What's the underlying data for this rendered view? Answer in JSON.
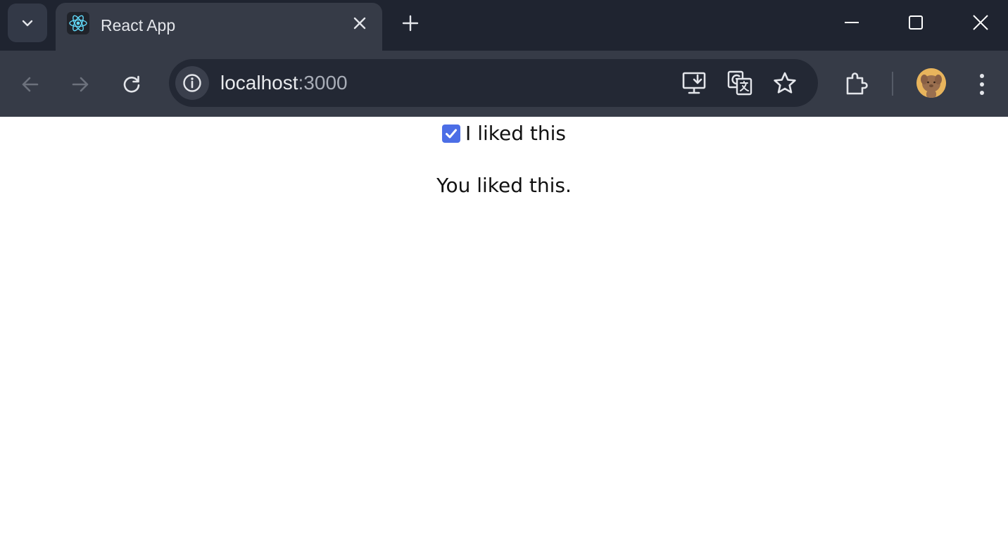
{
  "browser": {
    "tab": {
      "title": "React App",
      "favicon": "react-logo-icon"
    },
    "address_bar": {
      "host": "localhost",
      "port": ":3000"
    },
    "icons": {
      "tab_search": "chevron-down-icon",
      "tab_close": "close-icon",
      "new_tab": "plus-icon",
      "minimize": "minimize-icon",
      "maximize": "maximize-icon",
      "close_window": "close-icon",
      "back": "arrow-left-icon",
      "forward": "arrow-right-icon",
      "reload": "reload-icon",
      "site_info": "info-icon",
      "install_app": "install-app-icon",
      "translate": "translate-icon",
      "bookmark": "star-icon",
      "extensions": "puzzle-icon",
      "profile": "avatar",
      "menu": "more-vert-icon"
    },
    "colors": {
      "titlebar": "#1f2430",
      "toolbar": "#363b47",
      "omnibox": "#232834",
      "checkbox_accent": "#4c6ee6"
    }
  },
  "page": {
    "checkbox": {
      "label": "I liked this",
      "checked": true
    },
    "message": "You liked this."
  }
}
